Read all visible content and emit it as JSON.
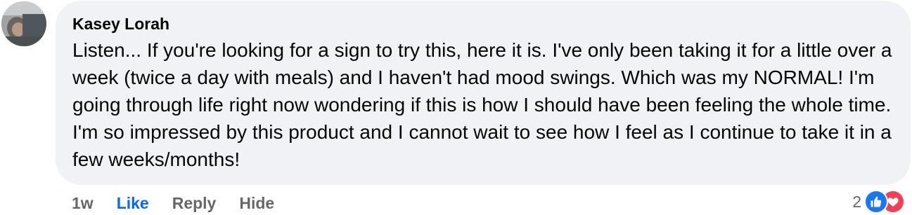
{
  "comment": {
    "author": "Kasey Lorah",
    "text": "Listen... If you're looking for a sign to try this, here it is. I've only been taking it for a little over a week (twice a day with meals) and I haven't had mood swings. Which was my NORMAL! I'm going through life right now wondering if this is how I should have been feeling the whole time. I'm so impressed by this product and I cannot wait to see how I feel as I continue to take it in a few weeks/months!",
    "avatar_icon": "user-avatar-photo"
  },
  "actions": {
    "time": "1w",
    "like_label": "Like",
    "reply_label": "Reply",
    "hide_label": "Hide",
    "like_color": "#0866ff"
  },
  "reactions": {
    "count": "2",
    "icons": [
      "thumbs-up-icon",
      "heart-icon"
    ],
    "like_color": "#1877f2",
    "love_color": "#f33e58"
  },
  "colors": {
    "bubble_bg": "#f0f2f5",
    "text": "#050505",
    "secondary": "#65676b"
  }
}
